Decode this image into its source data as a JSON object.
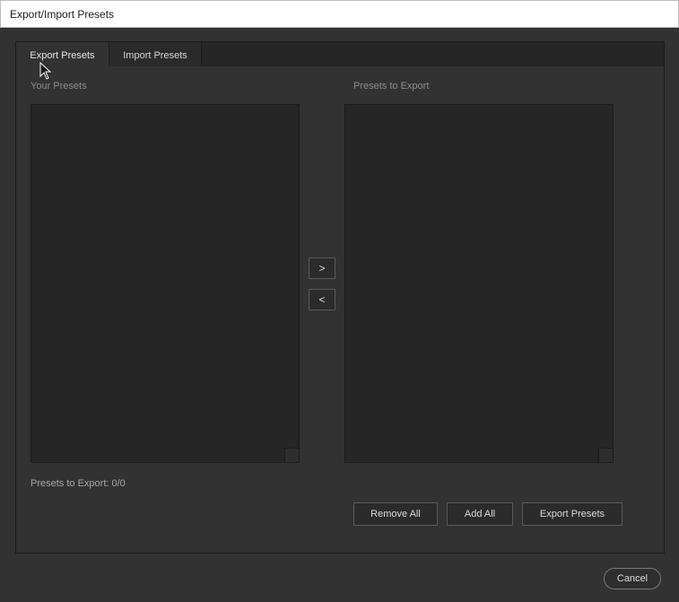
{
  "window": {
    "title": "Export/Import Presets"
  },
  "tabs": [
    {
      "label": "Export Presets",
      "active": true
    },
    {
      "label": "Import Presets",
      "active": false
    }
  ],
  "left_list": {
    "label": "Your Presets",
    "items": []
  },
  "right_list": {
    "label": "Presets to Export",
    "items": []
  },
  "transfer": {
    "add_label": ">",
    "remove_label": "<"
  },
  "status": {
    "text": "Presets to Export: 0/0"
  },
  "actions": {
    "remove_all": "Remove All",
    "add_all": "Add All",
    "export": "Export Presets"
  },
  "footer": {
    "cancel": "Cancel"
  }
}
